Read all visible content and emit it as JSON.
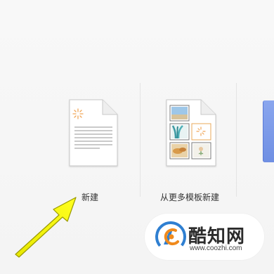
{
  "tiles": [
    {
      "label": "新建",
      "icon": "blank-document-icon"
    },
    {
      "label": "从更多模板新建",
      "icon": "template-document-icon"
    }
  ],
  "watermark": {
    "brand": "酷知网",
    "url": "www.coozhi.com",
    "logo_icon": "coozhi-logo-icon"
  },
  "annotation": {
    "arrow_icon": "yellow-arrow-icon",
    "arrow_color": "#f5f500"
  },
  "colors": {
    "background": "#f7f7f7",
    "partial_tile_blue": "#7b97e8",
    "logo_orange": "#f08a1c",
    "logo_blue": "#2f7fd1"
  }
}
